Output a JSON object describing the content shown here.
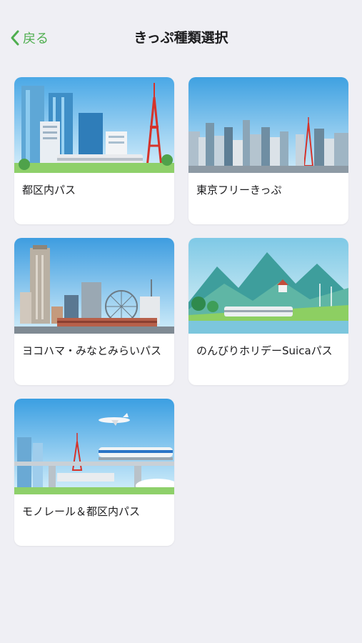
{
  "nav": {
    "back_label": "戻る",
    "title": "きっぷ種類選択"
  },
  "cards": [
    {
      "label": "都区内パス"
    },
    {
      "label": "東京フリーきっぷ"
    },
    {
      "label": "ヨコハマ・みなとみらいパス"
    },
    {
      "label": "のんびりホリデーSuicaパス"
    },
    {
      "label": "モノレール＆都区内パス"
    }
  ],
  "colors": {
    "accent": "#4fae4f",
    "background": "#efeff4",
    "card": "#ffffff"
  }
}
